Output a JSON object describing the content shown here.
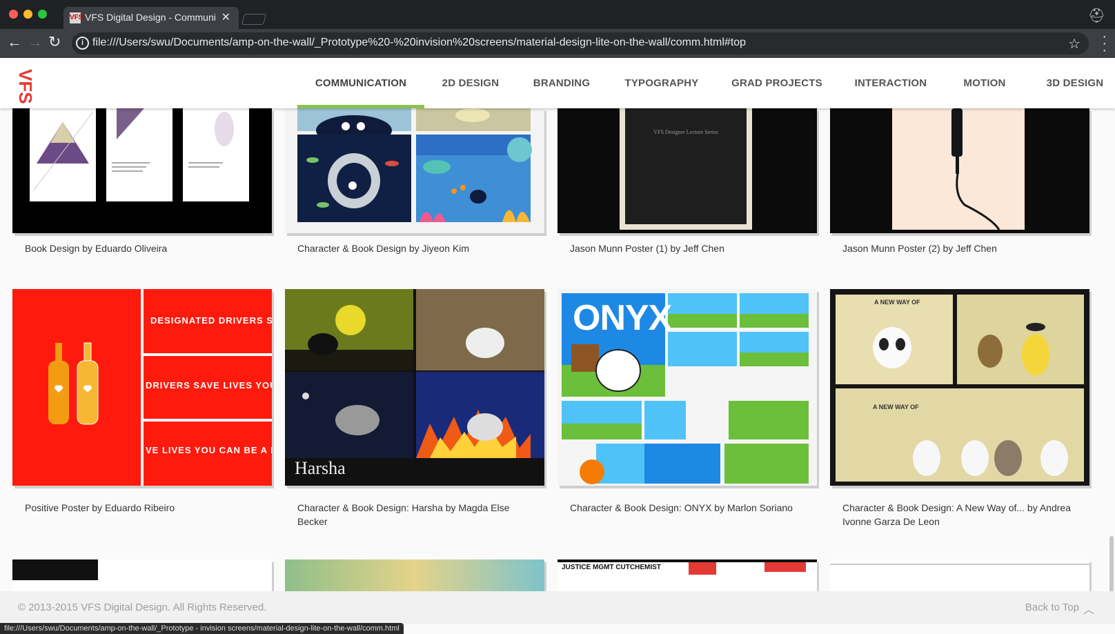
{
  "browser": {
    "tab_title": "VFS Digital Design - Communi",
    "tab_favicon": "VFS",
    "url": "file:///Users/swu/Documents/amp-on-the-wall/_Prototype%20-%20invision%20screens/material-design-lite-on-the-wall/comm.html#top",
    "status_url": "file:///Users/swu/Documents/amp-on-the-wall/_Prototype - invision screens/material-design-lite-on-the-wall/comm.html"
  },
  "site": {
    "logo": "VFS",
    "nav": [
      {
        "label": "COMMUNICATION",
        "active": true
      },
      {
        "label": "2D DESIGN"
      },
      {
        "label": "BRANDING"
      },
      {
        "label": "TYPOGRAPHY"
      },
      {
        "label": "GRAD PROJECTS"
      },
      {
        "label": "INTERACTION"
      },
      {
        "label": "MOTION"
      },
      {
        "label": "3D DESIGN"
      }
    ],
    "accent_color": "#8bc34a"
  },
  "projects": [
    {
      "caption": "Book Design by Eduardo Oliveira"
    },
    {
      "caption": "Character & Book Design by Jiyeon Kim"
    },
    {
      "caption": "Jason Munn Poster (1) by Jeff Chen"
    },
    {
      "caption": "Jason Munn Poster (2) by Jeff Chen"
    },
    {
      "caption": "Positive Poster by Eduardo Ribeiro"
    },
    {
      "caption": "Character & Book Design: Harsha by Magda Else Becker"
    },
    {
      "caption": "Character & Book Design: ONYX by Marlon Soriano"
    },
    {
      "caption": "Character & Book Design: A New Way of... by Andrea Ivonne Garza De Leon"
    }
  ],
  "thumb_text": {
    "poster_series": "VFS Designer Lecture Series",
    "red_line1": "DESIGNATED DRIVERS SAVE LIV",
    "red_line2": "DRIVERS SAVE LIVES YOU CAN BE",
    "red_line3": "VE LIVES YOU CAN BE A HERO.",
    "harsha_title": "Harsha",
    "onyx_title": "ONYX",
    "newway_1": "A NEW WAY OF",
    "newway_2": "A NEW WAY OF",
    "comic_strip": "JUSTICE MGMT CUTCHEMIST"
  },
  "footer": {
    "copyright": "© 2013-2015 VFS Digital Design. All Rights Reserved.",
    "back_to_top": "Back to Top"
  }
}
